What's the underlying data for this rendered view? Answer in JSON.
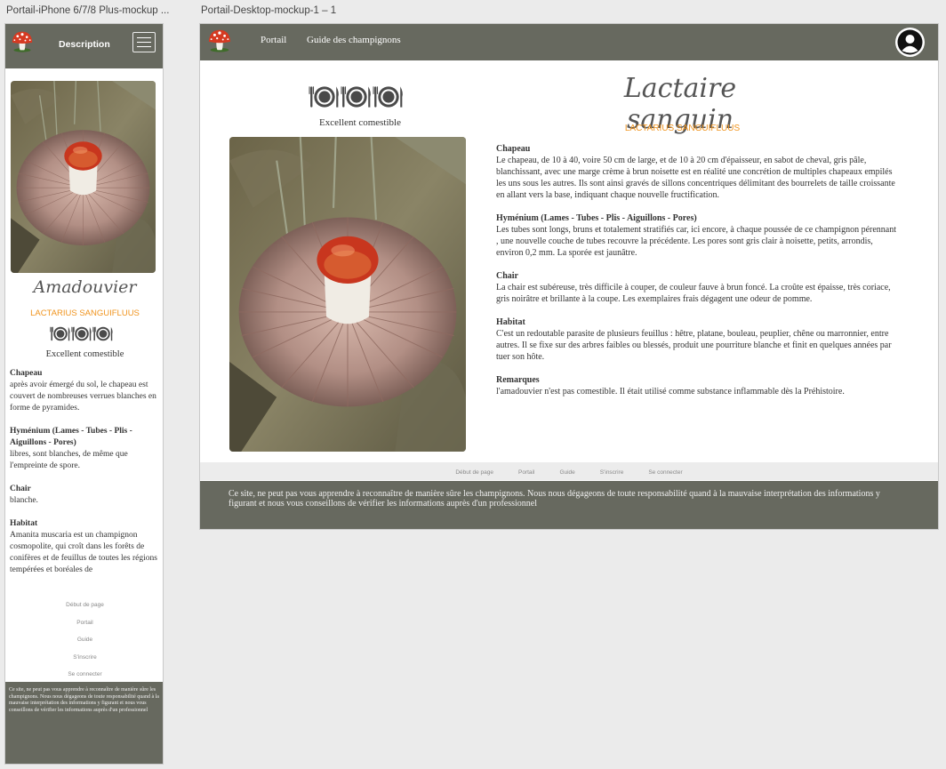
{
  "artboards": {
    "mobile_label": "Portail-iPhone 6/7/8 Plus-mockup ...",
    "desktop_label": "Portail-Desktop-mockup-1 – 1"
  },
  "mobile": {
    "header_title": "Description",
    "name": "Amadouvier",
    "latin_name": "LACTARIUS SANGUIFLUUS",
    "edibility": "Excellent comestible",
    "sections": [
      {
        "title": "Chapeau",
        "text": "après avoir émergé du sol, le chapeau est couvert de nombreuses verrues blanches en forme de pyramides."
      },
      {
        "title": "Hyménium (Lames - Tubes - Plis - Aiguillons - Pores)",
        "text": "libres, sont blanches, de même que l'empreinte de spore."
      },
      {
        "title": "Chair",
        "text": "blanche."
      },
      {
        "title": "Habitat",
        "text": "Amanita muscaria est un champignon cosmopolite, qui croît dans les forêts de conifères et de feuillus de toutes les régions tempérées et boréales de"
      }
    ],
    "footer_links": [
      "Début de page",
      "Portail",
      "Guide",
      "S'inscrire",
      "Se connecter"
    ],
    "footer_text": "Ce site, ne peut pas vous apprendre à reconnaître de manière sûre les champignons. Nous nous dégageons de toute responsabilité quand à la mauvaise interprétation des informations y figurant et nous vous conseillons de vérifier les informations auprès d'un professionnel"
  },
  "desktop": {
    "nav": {
      "portail": "Portail",
      "guide": "Guide des champignons"
    },
    "name": "Lactaire sanguin",
    "latin_name": "LACTARIUS SANGUIFLUUS",
    "edibility": "Excellent comestible",
    "sections": [
      {
        "title": "Chapeau",
        "text": "Le chapeau, de 10 à 40, voire 50 cm de large, et de 10 à 20 cm d'épaisseur, en sabot de cheval, gris pâle, blanchissant, avec une marge crème à brun noisette est en réalité une concrétion de multiples chapeaux empilés les uns sous les autres. Ils sont ainsi gravés de sillons concentriques délimitant des bourrelets de taille croissante en allant vers la base, indiquant chaque nouvelle fructification."
      },
      {
        "title": "Hyménium (Lames - Tubes - Plis - Aiguillons - Pores)",
        "text": "Les tubes sont longs, bruns et totalement stratifiés car, ici encore, à chaque poussée de ce champignon pérennant , une nouvelle couche de tubes recouvre la précédente. Les pores sont gris clair à noisette, petits, arrondis, environ 0,2 mm. La sporée est jaunâtre."
      },
      {
        "title": "Chair",
        "text": "La chair est subéreuse, très difficile à couper, de couleur fauve à brun foncé. La croûte est épaisse, très coriace, gris noirâtre et brillante à la coupe. Les exemplaires frais dégagent une odeur de pomme."
      },
      {
        "title": "Habitat",
        "text": "C'est un redoutable parasite de plusieurs feuillus : hêtre, platane, bouleau, peuplier, chêne ou marronnier, entre autres. Il se fixe sur des arbres faibles ou blessés, produit une pourriture blanche et finit en quelques années par tuer son hôte."
      },
      {
        "title": "Remarques",
        "text": "l'amadouvier n'est pas comestible. Il était utilisé comme substance inflammable dès la Préhistoire."
      }
    ],
    "footer_links": [
      "Début de page",
      "Portail",
      "Guide",
      "S'inscrire",
      "Se connecter"
    ],
    "footer_text": "Ce site, ne peut pas vous apprendre à reconnaître de manière sûre les champignons. Nous nous dégageons de toute responsabilité quand à la mauvaise interprétation des informations y figurant et nous vous conseillons de vérifier les informations auprès d'un professionnel"
  },
  "icons": {
    "logo": "mushroom-logo-icon",
    "menu": "hamburger-menu-icon",
    "avatar": "user-avatar-icon",
    "edibility": "plate-cutlery-icon"
  },
  "colors": {
    "header_bg": "#67695f",
    "accent_orange": "#f0941e",
    "mushroom_cap": "#c8361e"
  }
}
